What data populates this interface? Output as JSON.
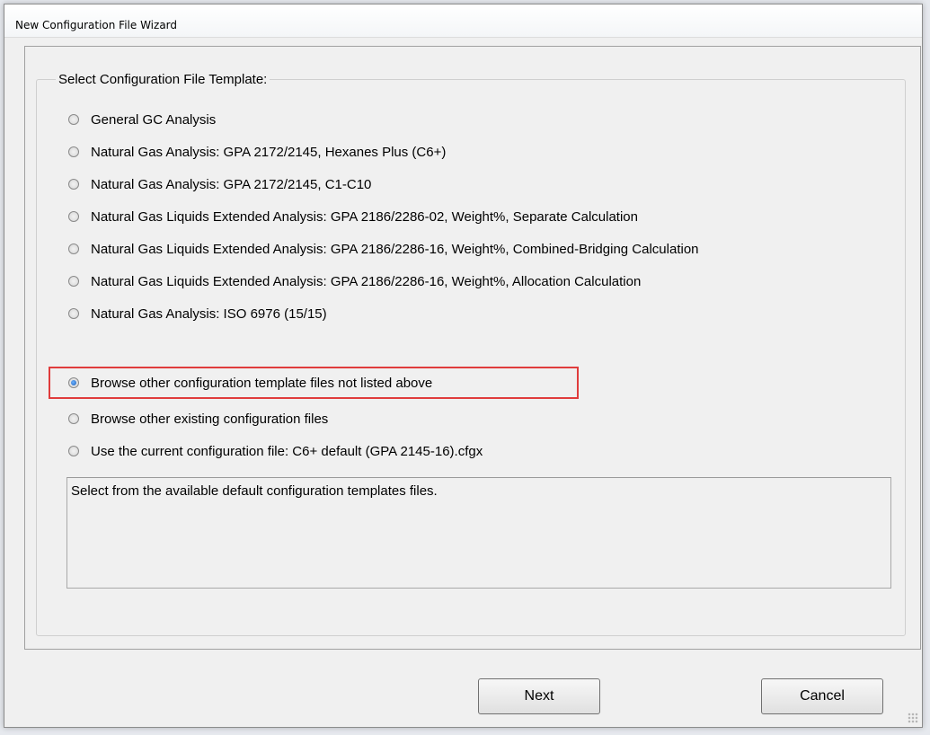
{
  "window": {
    "title": "New Configuration File Wizard"
  },
  "group": {
    "legend": "Select Configuration File Template:"
  },
  "options": [
    {
      "label": "General GC Analysis",
      "checked": false
    },
    {
      "label": "Natural Gas Analysis: GPA 2172/2145, Hexanes Plus (C6+)",
      "checked": false
    },
    {
      "label": "Natural Gas Analysis: GPA 2172/2145, C1-C10",
      "checked": false
    },
    {
      "label": "Natural Gas Liquids Extended Analysis: GPA 2186/2286-02, Weight%, Separate Calculation",
      "checked": false
    },
    {
      "label": "Natural Gas Liquids Extended Analysis: GPA 2186/2286-16, Weight%, Combined-Bridging Calculation",
      "checked": false
    },
    {
      "label": "Natural Gas Liquids Extended Analysis: GPA 2186/2286-16, Weight%, Allocation Calculation",
      "checked": false
    },
    {
      "label": "Natural Gas Analysis:  ISO 6976 (15/15)",
      "checked": false
    },
    {
      "label": "Browse other configuration template files not listed above",
      "checked": true
    },
    {
      "label": "Browse other existing configuration files",
      "checked": false
    },
    {
      "label": "Use the current configuration file: C6+ default (GPA 2145-16).cfgx",
      "checked": false
    }
  ],
  "description": "Select from the available default configuration templates files.",
  "buttons": {
    "next": "Next",
    "cancel": "Cancel"
  },
  "colors": {
    "highlight": "#e03c3c",
    "radio_selected": "#1e5fb8"
  }
}
